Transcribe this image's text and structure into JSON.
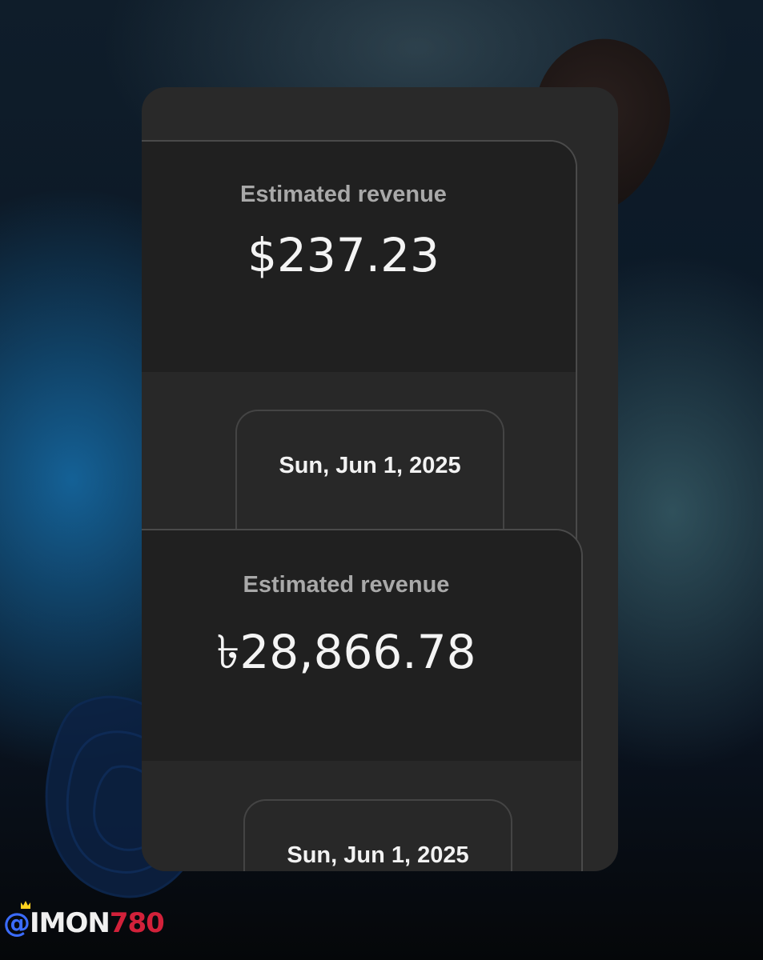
{
  "cards": [
    {
      "label": "Estimated revenue",
      "value": "$237.23",
      "date": "Sun, Jun 1, 2025"
    },
    {
      "label": "Estimated revenue",
      "value": "৳28,866.78",
      "date": "Sun, Jun 1, 2025"
    }
  ],
  "watermark": {
    "at": "@",
    "i": "I",
    "mon": "MON",
    "num": "780"
  },
  "colors": {
    "card_bg": "#292929",
    "panel_top": "#202020",
    "label": "#a9a9a9",
    "value": "#f4f4f4",
    "watermark_at": "#3b6cff",
    "watermark_num": "#d2213a"
  }
}
